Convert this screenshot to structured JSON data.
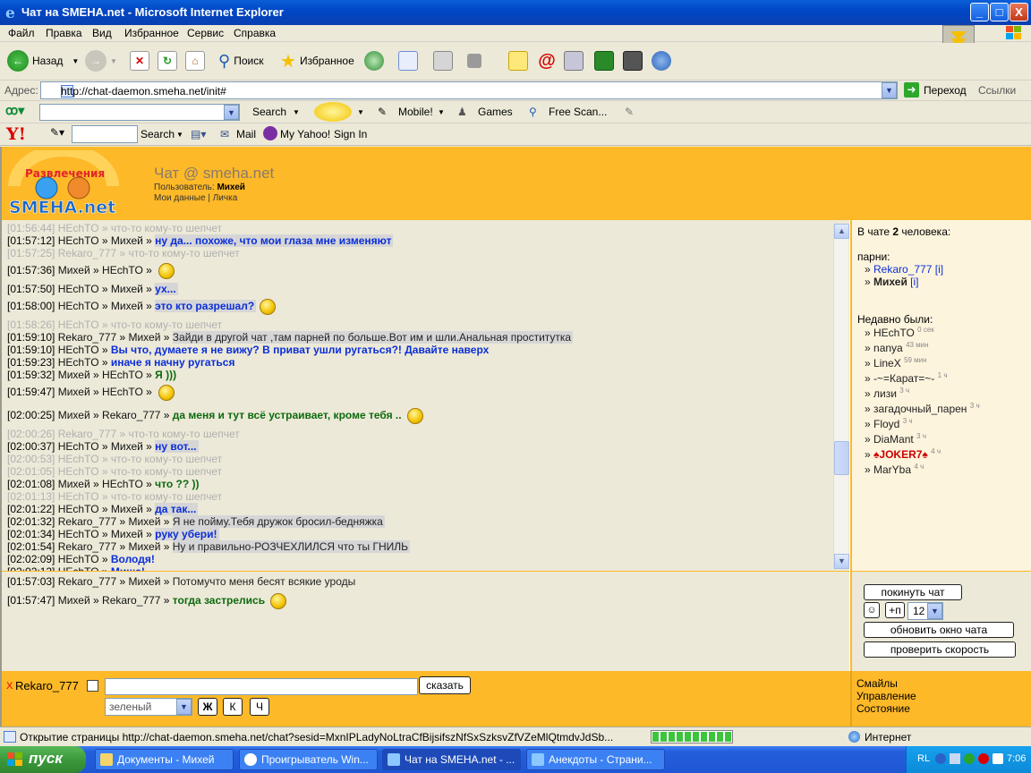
{
  "window": {
    "title": "Чат на SMEHA.net - Microsoft Internet Explorer",
    "buttons": {
      "minimize": "_",
      "maximize": "□",
      "close": "X"
    }
  },
  "menu": [
    "Файл",
    "Правка",
    "Вид",
    "Избранное",
    "Сервис",
    "Справка"
  ],
  "toolbar": {
    "back": "Назад",
    "search": "Поиск",
    "favorites": "Избранное"
  },
  "address": {
    "label": "Адрес:",
    "url": "http://chat-daemon.smeha.net/init#",
    "go": "Переход",
    "links": "Ссылки"
  },
  "search_toolbar": {
    "search_btn": "Search",
    "mobile": "Mobile!",
    "games": "Games",
    "free_scan": "Free Scan..."
  },
  "yahoo_toolbar": {
    "logo": "Y!",
    "search_btn": "Search",
    "mail": "Mail",
    "my_yahoo": "My Yahoo!",
    "sign_in": "Sign In"
  },
  "page": {
    "logo_text": "Развлечения на SMEHA.net",
    "title": "Чат @ smeha.net",
    "user_label": "Пользователь:",
    "user_name": "Михей",
    "my_data": "Мои данные",
    "sep": "|",
    "private": "Личка"
  },
  "chat": [
    {
      "time": "[01:56:44]",
      "from": "HEchTO",
      "to": "",
      "text": "что-то кому-то шепчет",
      "style": "whisper"
    },
    {
      "time": "[01:57:12]",
      "from": "HEchTO",
      "to": "Михей",
      "text": "ну да... похоже, что мои глаза мне изменяют",
      "style": "blue-priv"
    },
    {
      "time": "[01:57:25]",
      "from": "Rekaro_777",
      "to": "",
      "text": "что-то кому-то шепчет",
      "style": "whisper"
    },
    {
      "time": "[01:57:36]",
      "from": "Михей",
      "to": "HEchTO",
      "text": "",
      "style": "smile"
    },
    {
      "time": "[01:57:50]",
      "from": "HEchTO",
      "to": "Михей",
      "text": "ух...",
      "style": "blue-priv"
    },
    {
      "time": "[01:58:00]",
      "from": "HEchTO",
      "to": "Михей",
      "text": "это кто разрешал?",
      "style": "blue-priv-smile"
    },
    {
      "time": "[01:58:26]",
      "from": "HEchTO",
      "to": "",
      "text": "что-то кому-то шепчет",
      "style": "whisper"
    },
    {
      "time": "[01:59:10]",
      "from": "Rekaro_777",
      "to": "Михей",
      "text": "Зайди в другой чат ,там парней по больше.Вот им и шли.Анальная проститутка",
      "style": "plain-priv"
    },
    {
      "time": "[01:59:10]",
      "from": "HEchTO",
      "to": "",
      "text": "Вы что, думаете я не вижу? В приват ушли ругаться?! Давайте наверх",
      "style": "blue"
    },
    {
      "time": "[01:59:23]",
      "from": "HEchTO",
      "to": "",
      "text": "иначе я начну ругаться",
      "style": "blue"
    },
    {
      "time": "[01:59:32]",
      "from": "Михей",
      "to": "HEchTO",
      "text": "Я )))",
      "style": "green"
    },
    {
      "time": "[01:59:47]",
      "from": "Михей",
      "to": "HEchTO",
      "text": "",
      "style": "smile"
    },
    {
      "time": "[02:00:25]",
      "from": "Михей",
      "to": "Rekaro_777",
      "text": "да меня и тут всё устраивает, кроме тебя ..",
      "style": "green-smile"
    },
    {
      "time": "[02:00:26]",
      "from": "Rekaro_777",
      "to": "",
      "text": "что-то кому-то шепчет",
      "style": "whisper"
    },
    {
      "time": "[02:00:37]",
      "from": "HEchTO",
      "to": "Михей",
      "text": "ну вот...",
      "style": "blue-priv"
    },
    {
      "time": "[02:00:53]",
      "from": "HEchTO",
      "to": "",
      "text": "что-то кому-то шепчет",
      "style": "whisper"
    },
    {
      "time": "[02:01:05]",
      "from": "HEchTO",
      "to": "",
      "text": "что-то кому-то шепчет",
      "style": "whisper"
    },
    {
      "time": "[02:01:08]",
      "from": "Михей",
      "to": "HEchTO",
      "text": "что ?? ))",
      "style": "green"
    },
    {
      "time": "[02:01:13]",
      "from": "HEchTO",
      "to": "",
      "text": "что-то кому-то шепчет",
      "style": "whisper"
    },
    {
      "time": "[02:01:22]",
      "from": "HEchTO",
      "to": "Михей",
      "text": "да так...",
      "style": "blue-priv"
    },
    {
      "time": "[02:01:32]",
      "from": "Rekaro_777",
      "to": "Михей",
      "text": "Я не пойму.Тебя дружок бросил-бедняжка",
      "style": "plain-priv"
    },
    {
      "time": "[02:01:34]",
      "from": "HEchTO",
      "to": "Михей",
      "text": "руку убери!",
      "style": "blue-priv"
    },
    {
      "time": "[02:01:54]",
      "from": "Rekaro_777",
      "to": "Михей",
      "text": "Ну и правильно-РОЗЧЕХЛИЛСЯ что ты ГНИЛЬ",
      "style": "plain-priv"
    },
    {
      "time": "[02:02:09]",
      "from": "HEchTO",
      "to": "",
      "text": "Володя!",
      "style": "blue"
    },
    {
      "time": "[02:02:12]",
      "from": "HEchTO",
      "to": "",
      "text": "Миша!",
      "style": "blue"
    }
  ],
  "private_log": [
    {
      "time": "[01:57:03]",
      "from": "Rekaro_777",
      "to": "Михей",
      "text": "Потомучто меня бесят всякие уроды",
      "style": "plain"
    },
    {
      "time": "[01:57:47]",
      "from": "Михей",
      "to": "Rekaro_777",
      "text": "тогда застрелись",
      "style": "green-smile"
    }
  ],
  "sidebar": {
    "count_prefix": "В чате",
    "count": "2",
    "count_suffix": "человека:",
    "guys_label": "парни:",
    "guys": [
      {
        "name": "Rekaro_777",
        "info": "[i]"
      },
      {
        "name": "Михей",
        "info": "[i]"
      }
    ],
    "recent_label": "Недавно были:",
    "recent": [
      {
        "name": "HEchTO",
        "ago": "0 сек"
      },
      {
        "name": "nanya",
        "ago": "43 мин"
      },
      {
        "name": "LineX",
        "ago": "59 мин"
      },
      {
        "name": "-~=Карат=~-",
        "ago": "1 ч"
      },
      {
        "name": "лизи",
        "ago": "3 ч"
      },
      {
        "name": "загадочный_парен",
        "ago": "3 ч"
      },
      {
        "name": "Floyd",
        "ago": "3 ч"
      },
      {
        "name": "DiaMant",
        "ago": "3 ч"
      },
      {
        "name": "♠JOKER7♠",
        "ago": "4 ч"
      },
      {
        "name": "MarYba",
        "ago": "4 ч"
      }
    ]
  },
  "controls": {
    "leave": "покинуть чат",
    "plus_p": "+п",
    "font_size": "12",
    "refresh": "обновить окно чата",
    "speed": "проверить скорость"
  },
  "input": {
    "close_x": "X",
    "recipient": "Rekaro_777",
    "say": "сказать",
    "color": "зеленый",
    "bold": "Ж",
    "italic": "К",
    "underline": "Ч"
  },
  "bottom_links": [
    "Смайлы",
    "Управление",
    "Состояние"
  ],
  "status": {
    "text": "Открытие страницы http://chat-daemon.smeha.net/chat?sesid=MxnIPLadyNoLtraCfBijsifszNfSxSzksvZfVZeMlQtmdvJdSb...",
    "progress": 1.0,
    "zone": "Интернет"
  },
  "taskbar": {
    "start": "пуск",
    "tasks": [
      "Документы - Михей",
      "Проигрыватель Win...",
      "Чат на SMEHA.net - ...",
      "Анекдоты - Страни..."
    ],
    "lang": "RL",
    "clock": "7:06"
  },
  "colors": {
    "header": "#fdb928",
    "chat_bg": "#ece9d8",
    "private_blue": "#0a2ed8",
    "green": "#0d6a0d"
  }
}
